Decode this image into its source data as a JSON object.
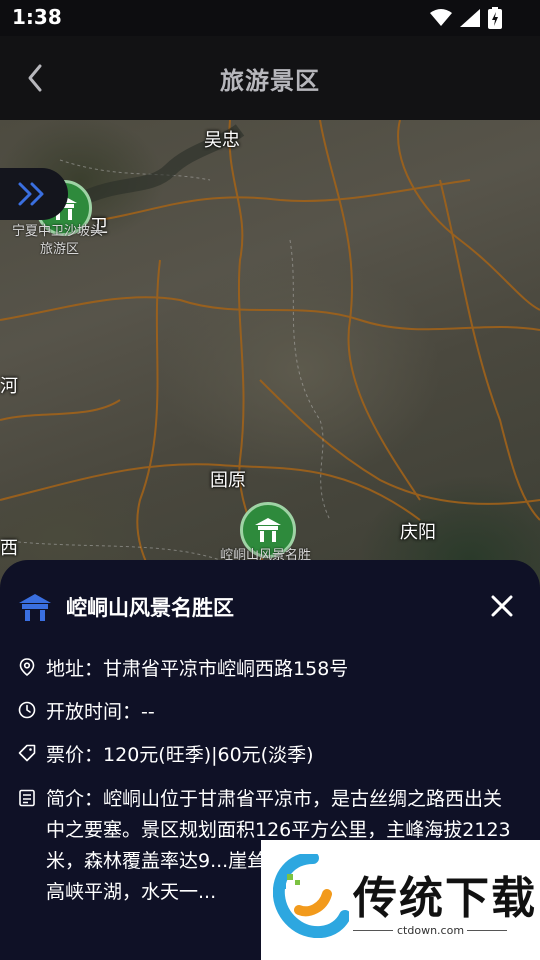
{
  "status_bar": {
    "time": "1:38"
  },
  "app_bar": {
    "title": "旅游景区"
  },
  "map": {
    "labels": {
      "wuzhong": "吴忠",
      "guyuan": "固原",
      "qingyang": "庆阳",
      "he": "河",
      "xi": "西",
      "wei": "卫"
    },
    "pois": [
      {
        "name": "宁夏中卫沙坡头旅游区",
        "line1": "宁夏中卫沙坡头",
        "line2": "旅游区"
      },
      {
        "name": "崆峒山风景名胜区",
        "line1": "崆峒山风景名胜"
      }
    ]
  },
  "detail": {
    "title": "崆峒山风景名胜区",
    "address_label": "地址：",
    "address": "甘肃省平凉市崆峒西路158号",
    "hours_label": "开放时间：",
    "hours": "--",
    "price_label": "票价：",
    "price": "120元(旺季)|60元(淡季)",
    "intro_label": "简介：",
    "intro": "崆峒山位于甘肃省平凉市，是古丝绸之路西出关中之要塞。景区规划面积126平方公里，主峰海拔2123米，森林覆盖率达9...崖耸立，似鬼斧神工；林...仙境；高峡平湖，水天一..."
  },
  "watermark": {
    "text": "传统下载",
    "url": "ctdown.com"
  },
  "colors": {
    "sheet_bg": "#0f1126",
    "accent_blue": "#3a6fe0",
    "poi_green": "#2e8a3c"
  }
}
